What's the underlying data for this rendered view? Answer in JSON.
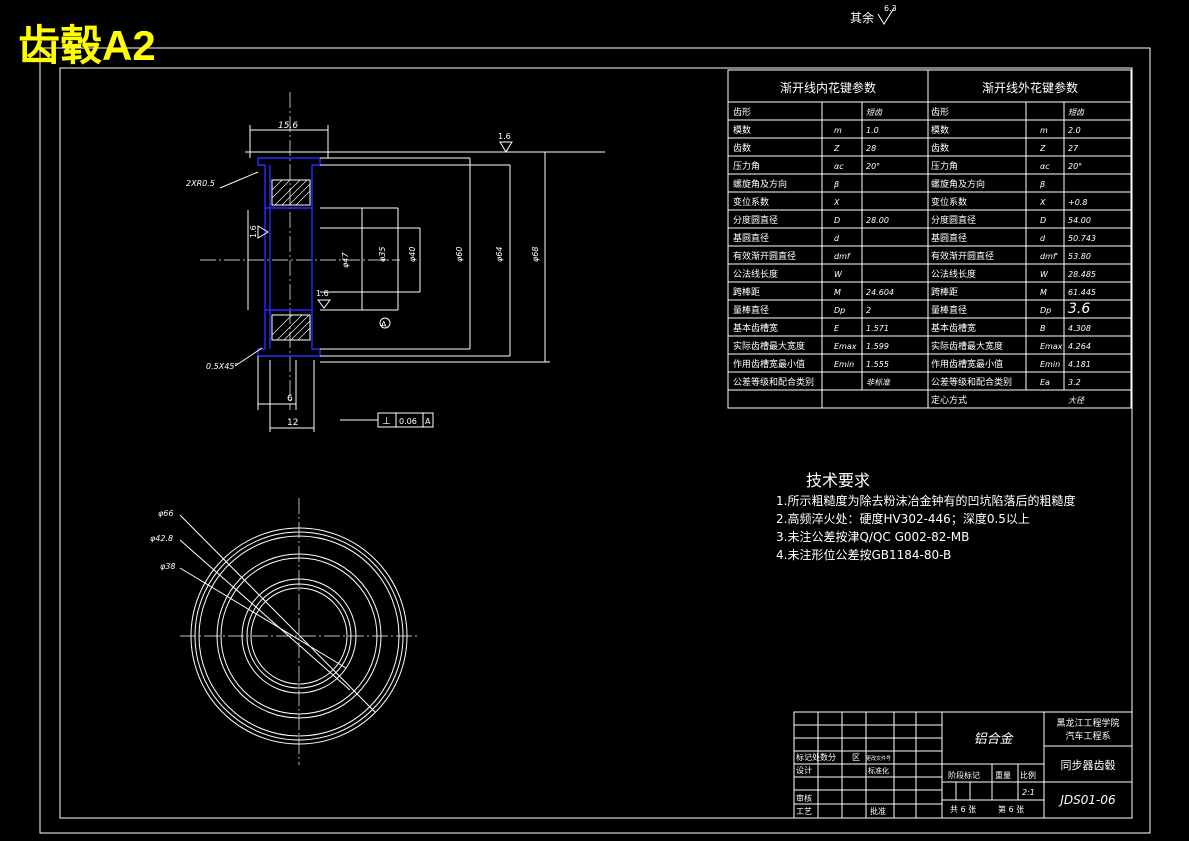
{
  "banner_title": "齿毂A2",
  "roughness_rest": "其余",
  "roughness_rest_value": "6.3",
  "drawing": {
    "roughness_top": "1.6",
    "roughness_left": "1.6",
    "roughness_inner": "1.6",
    "dims": {
      "width_top": "15.6",
      "chamfer_r": "2XR0.5",
      "chamfer_45": "0.5X45°",
      "d47": "φ47",
      "d35": "φ35",
      "d40": "φ40",
      "d60": "φ60",
      "d64": "φ64",
      "d68": "φ68",
      "w6": "6",
      "w12": "12",
      "datum": "A"
    },
    "tolerance": {
      "symbol": "⊥",
      "value": "0.06",
      "datum": "A"
    },
    "circle_dims": {
      "d66": "φ66",
      "d42_8": "φ42.8",
      "d38": "φ38"
    }
  },
  "spline_table": {
    "inner_title": "渐开线内花键参数",
    "outer_title": "渐开线外花键参数",
    "rows": [
      {
        "iname": "齿形",
        "isym": "",
        "ival": "短齿",
        "oname": "齿形",
        "osym": "",
        "oval": "短齿"
      },
      {
        "iname": "模数",
        "isym": "m",
        "ival": "1.0",
        "oname": "模数",
        "osym": "m",
        "oval": "2.0"
      },
      {
        "iname": "齿数",
        "isym": "Z",
        "ival": "28",
        "oname": "齿数",
        "osym": "Z",
        "oval": "27"
      },
      {
        "iname": "压力角",
        "isym": "αc",
        "ival": "20°",
        "oname": "压力角",
        "osym": "αc",
        "oval": "20°"
      },
      {
        "iname": "螺旋角及方向",
        "isym": "β",
        "ival": "",
        "oname": "螺旋角及方向",
        "osym": "β",
        "oval": ""
      },
      {
        "iname": "变位系数",
        "isym": "X",
        "ival": "",
        "oname": "变位系数",
        "osym": "X",
        "oval": "+0.8"
      },
      {
        "iname": "分度圆直径",
        "isym": "D",
        "ival": "28.00",
        "oname": "分度圆直径",
        "osym": "D",
        "oval": "54.00"
      },
      {
        "iname": "基圆直径",
        "isym": "d",
        "ival": "",
        "oname": "基圆直径",
        "osym": "d",
        "oval": "50.743"
      },
      {
        "iname": "有效渐开圆直径",
        "isym": "dmf",
        "ival": "",
        "oname": "有效渐开圆直径",
        "osym": "dmf'",
        "oval": "53.80"
      },
      {
        "iname": "公法线长度",
        "isym": "W",
        "ival": "",
        "oname": "公法线长度",
        "osym": "W",
        "oval": "28.485"
      },
      {
        "iname": "跨棒距",
        "isym": "M",
        "ival": "24.604",
        "oname": "跨棒距",
        "osym": "M",
        "oval": "61.445"
      },
      {
        "iname": "量棒直径",
        "isym": "Dp",
        "ival": "2",
        "oname": "量棒直径",
        "osym": "Dp",
        "oval": "3.6"
      },
      {
        "iname": "基本齿槽宽",
        "isym": "E",
        "ival": "1.571",
        "oname": "基本齿槽宽",
        "osym": "B",
        "oval": "4.308"
      },
      {
        "iname": "实际齿槽最大宽度",
        "isym": "Emax",
        "ival": "1.599",
        "oname": "实际齿槽最大宽度",
        "osym": "Emax",
        "oval": "4.264"
      },
      {
        "iname": "作用齿槽宽最小值",
        "isym": "Emin",
        "ival": "1.555",
        "oname": "作用齿槽宽最小值",
        "osym": "Emin",
        "oval": "4.181"
      },
      {
        "iname": "公差等级和配合类别",
        "isym": "",
        "ival": "非标准",
        "oname": "公差等级和配合类别",
        "osym": "Ea",
        "oval": "3.2"
      },
      {
        "iname": "",
        "isym": "",
        "ival": "",
        "oname": "定心方式",
        "osym": "",
        "oval": "大径"
      }
    ]
  },
  "tech_req": {
    "title": "技术要求",
    "items": [
      "1.所示粗糙度为除去粉沫冶金钟有的凹坑陷落后的粗糙度",
      "2.高频淬火处：硬度HV302-446；深度0.5以上",
      "3.未注公差按津Q/QC G002-82-MB",
      "4.未注形位公差按GB1184-80-B"
    ]
  },
  "title_block": {
    "material": "铝合金",
    "school": "黑龙江工程学院",
    "dept": "汽车工程系",
    "part_name": "同步器齿毂",
    "drawing_no": "JDS01-06",
    "scale": "2:1",
    "stage_mark": "阶段标记",
    "weight": "重量",
    "ratio": "比例",
    "sheets": "共 6 张",
    "sheet_no": "第 6 张",
    "mark": "标记处数分",
    "zone": "区",
    "change_doc": "更改文件号",
    "design": "设计",
    "standardize": "标准化",
    "review": "审核",
    "process": "工艺",
    "approve": "批准"
  }
}
